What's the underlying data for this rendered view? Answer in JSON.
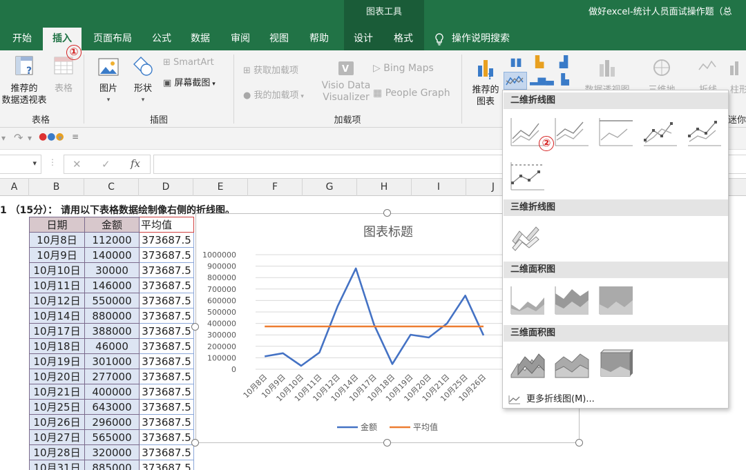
{
  "titlebar": {
    "contextual_group": "图表工具",
    "doc_title": "做好excel-统计人员面试操作题（总"
  },
  "tabs": [
    {
      "label": "开始"
    },
    {
      "label": "插入"
    },
    {
      "label": "页面布局"
    },
    {
      "label": "公式"
    },
    {
      "label": "数据"
    },
    {
      "label": "审阅"
    },
    {
      "label": "视图"
    },
    {
      "label": "帮助"
    },
    {
      "label": "设计"
    },
    {
      "label": "格式"
    },
    {
      "label": "操作说明搜索"
    }
  ],
  "ribbon": {
    "recommended_pivot": "推荐的\n数据透视表",
    "table": "表格",
    "group_tables": "表格",
    "picture": "图片",
    "shapes": "形状",
    "smartart": "SmartArt",
    "screenshot": "屏幕截图",
    "group_illustrations": "插图",
    "get_addins": "获取加载项",
    "my_addins": "我的加载项",
    "visio": "Visio Data\nVisualizer",
    "bing_maps": "Bing Maps",
    "people_graph": "People Graph",
    "group_addins": "加载项",
    "recommended_charts": "推荐的\n图表",
    "pivot_chart": "数据透视图",
    "3d_map": "三维地",
    "sparkline_line": "折线",
    "sparkline_col": "柱形",
    "sparklines_group": "迷你"
  },
  "formula_bar": {
    "fx": "fx",
    "cancel": "✕",
    "enter": "✓"
  },
  "columns": [
    "A",
    "B",
    "C",
    "D",
    "E",
    "F",
    "G",
    "H",
    "I",
    "J"
  ],
  "sheet": {
    "question": "1 （15分）： 请用以下表格数据绘制像右侧的折线图。",
    "headers": [
      "日期",
      "金额",
      "平均值"
    ],
    "rows": [
      [
        "10月8日",
        "112000",
        "373687.5"
      ],
      [
        "10月9日",
        "140000",
        "373687.5"
      ],
      [
        "10月10日",
        "30000",
        "373687.5"
      ],
      [
        "10月11日",
        "146000",
        "373687.5"
      ],
      [
        "10月12日",
        "550000",
        "373687.5"
      ],
      [
        "10月14日",
        "880000",
        "373687.5"
      ],
      [
        "10月17日",
        "388000",
        "373687.5"
      ],
      [
        "10月18日",
        "46000",
        "373687.5"
      ],
      [
        "10月19日",
        "301000",
        "373687.5"
      ],
      [
        "10月20日",
        "277000",
        "373687.5"
      ],
      [
        "10月21日",
        "400000",
        "373687.5"
      ],
      [
        "10月25日",
        "643000",
        "373687.5"
      ],
      [
        "10月26日",
        "296000",
        "373687.5"
      ],
      [
        "10月27日",
        "565000",
        "373687.5"
      ],
      [
        "10月28日",
        "320000",
        "373687.5"
      ],
      [
        "10月31日",
        "885000",
        "373687.5"
      ]
    ]
  },
  "chart_data": {
    "type": "line",
    "title": "图表标题",
    "categories": [
      "10月8日",
      "10月9日",
      "10月10日",
      "10月11日",
      "10月12日",
      "10月14日",
      "10月17日",
      "10月18日",
      "10月19日",
      "10月20日",
      "10月21日",
      "10月25日",
      "10月26日"
    ],
    "series": [
      {
        "name": "金额",
        "color": "#4472c4",
        "values": [
          112000,
          140000,
          30000,
          146000,
          550000,
          880000,
          388000,
          46000,
          301000,
          277000,
          400000,
          643000,
          296000
        ]
      },
      {
        "name": "平均值",
        "color": "#ed7d31",
        "values": [
          373687.5,
          373687.5,
          373687.5,
          373687.5,
          373687.5,
          373687.5,
          373687.5,
          373687.5,
          373687.5,
          373687.5,
          373687.5,
          373687.5,
          373687.5
        ]
      }
    ],
    "yticks": [
      "0",
      "100000",
      "200000",
      "300000",
      "400000",
      "500000",
      "600000",
      "700000",
      "800000",
      "900000",
      "1000000"
    ],
    "ylim": [
      0,
      1000000
    ],
    "grid": true,
    "legend": "bottom"
  },
  "gallery": {
    "sec_2d_line": "二维折线图",
    "sec_3d_line": "三维折线图",
    "sec_2d_area": "二维面积图",
    "sec_3d_area": "三维面积图",
    "more": "更多折线图(M)..."
  },
  "markers": {
    "one": "①",
    "two": "②"
  },
  "colors": {
    "excel_green": "#217346",
    "marker_red": "#d41f1f"
  }
}
